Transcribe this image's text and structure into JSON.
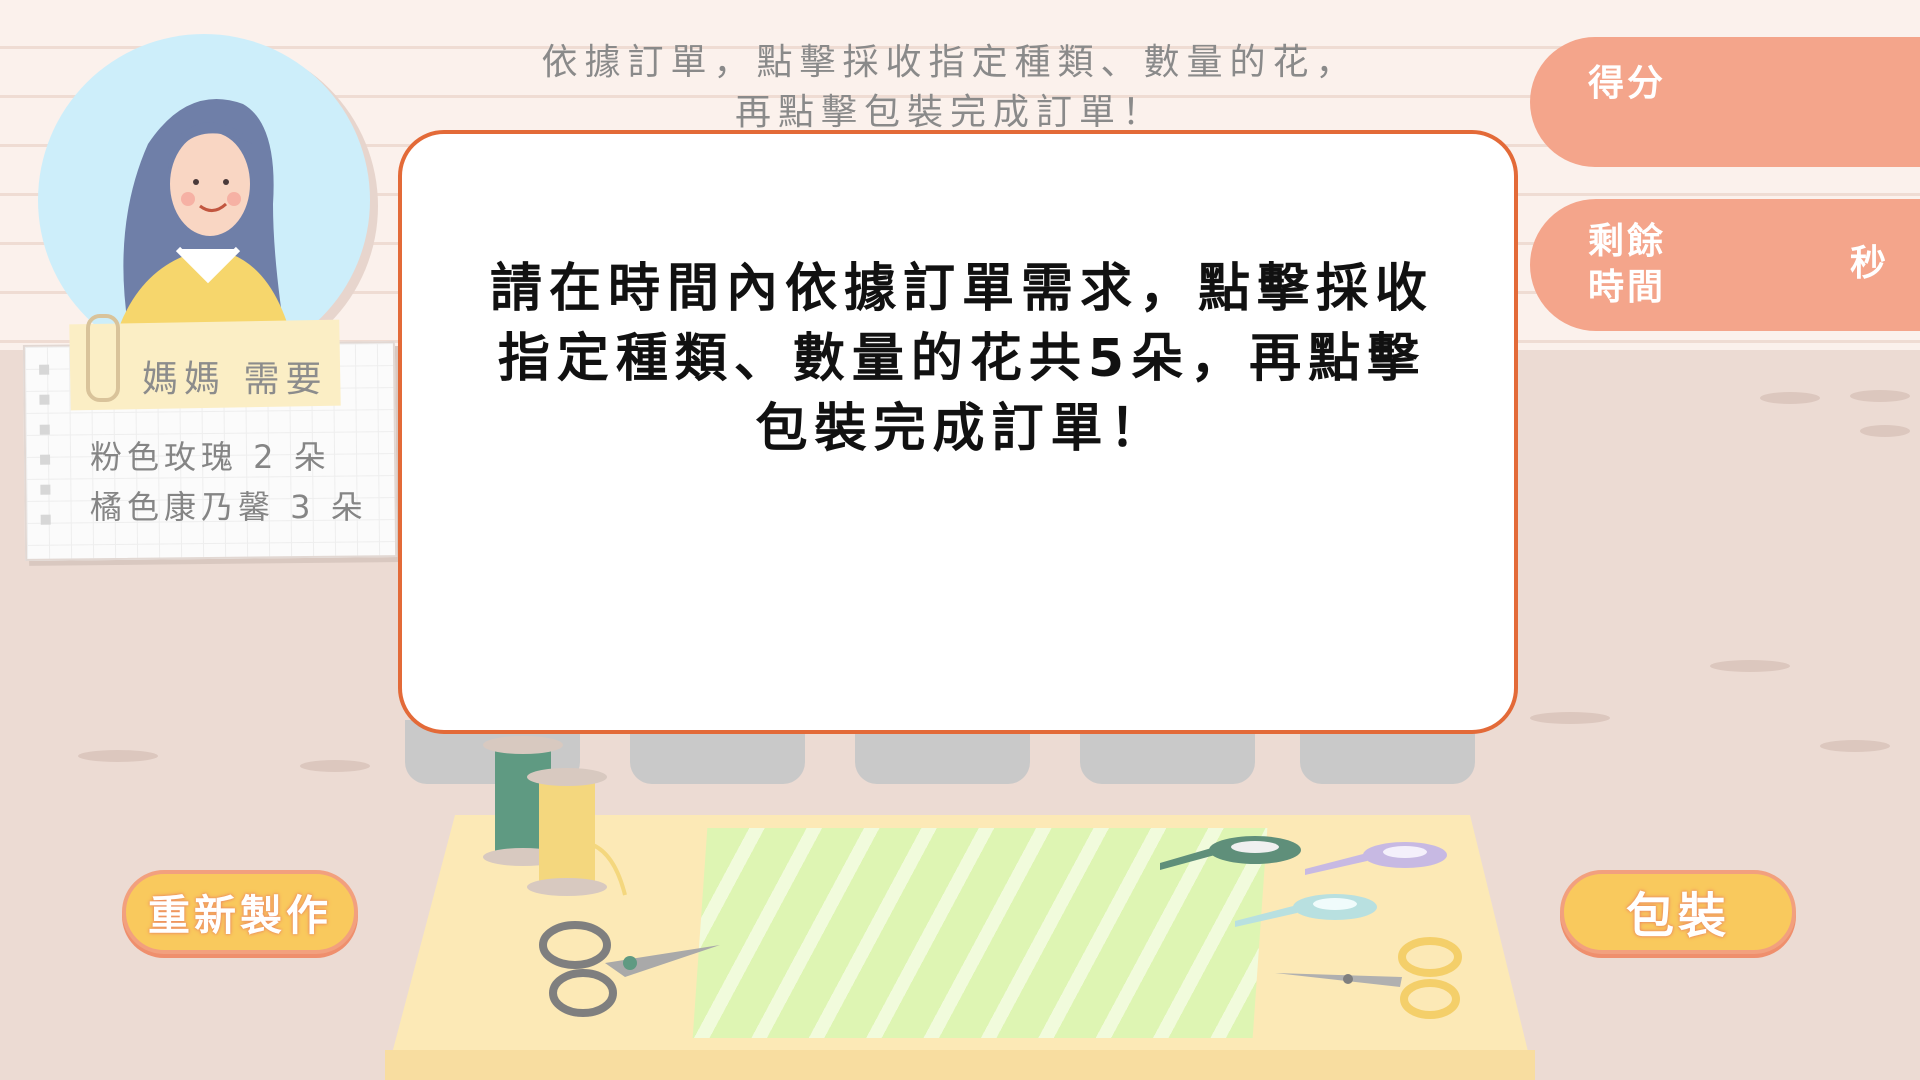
{
  "instruction": {
    "line1": "依據訂單，點擊採收指定種類、數量的花，",
    "line2": "再點擊包裝完成訂單！"
  },
  "order": {
    "title": "媽媽 需要",
    "items": [
      "粉色玫瑰 2 朵",
      "橘色康乃馨 3 朵"
    ]
  },
  "score": {
    "label": "得分"
  },
  "timer": {
    "label_line1": "剩餘",
    "label_line2": "時間",
    "unit": "秒"
  },
  "buttons": {
    "redo": "重新製作",
    "pack": "包裝"
  },
  "dialog": {
    "line1": "請在時間內依據訂單需求，點擊採收",
    "line2": "指定種類、數量的花共5朵，再點擊",
    "line3": "包裝完成訂單！"
  },
  "colors": {
    "accent": "#f4a58b",
    "button": "#f9c95d",
    "dialog_border": "#e36a38"
  }
}
